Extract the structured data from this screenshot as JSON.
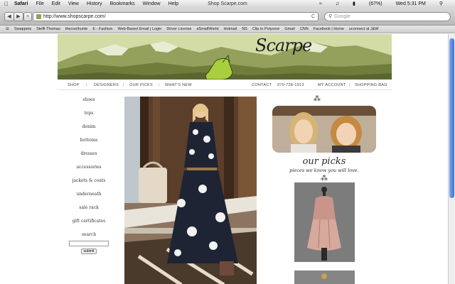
{
  "menubar": {
    "app": "Safari",
    "items": [
      "File",
      "Edit",
      "View",
      "History",
      "Bookmarks",
      "Window",
      "Help"
    ],
    "window_title": "Shop Scarpe.com",
    "battery": "(67%)",
    "clock": "Wed 5:31 PM"
  },
  "toolbar": {
    "url": "http://www.shopscarpe.com/",
    "search_placeholder": "Google",
    "reload_symbol": "C",
    "add_symbol": "+"
  },
  "bookmarks": [
    "Swappets",
    "Steffi Thomas",
    "thecoolhunte",
    "E - Fashion",
    "Web-Based Email | Login",
    "Driver License",
    "aSmallWorld",
    "Hotmail",
    "NS",
    "Clip to Polyvore",
    "Gmail",
    "CNN",
    "Facebook | Home",
    "uconnect at J&W"
  ],
  "site": {
    "logo": "Scarpe",
    "nav": {
      "shop": "SHOP",
      "designers": "DESIGNERS",
      "our_picks": "OUR PICKS",
      "whats_new": "WHAT'S NEW",
      "contact": "CONTACT",
      "phone": "970-728-1913",
      "my_account": "MY ACCOUNT",
      "shopping_bag": "SHOPPING BAG"
    },
    "categories": [
      "shoes",
      "tops",
      "denim",
      "bottoms",
      "dresses",
      "accessories",
      "jackets & coats",
      "underneath",
      "sale rack",
      "gift certificates",
      "search"
    ],
    "submit_label": "submit",
    "picks_title": "our picks",
    "picks_subtitle": "pieces we know you will love."
  },
  "colors": {
    "header_bg": "#cfd7a0",
    "mountains": "#7f8d4a",
    "boot": "#a9cf3e",
    "scroll_thumb": "#3b74d6"
  }
}
